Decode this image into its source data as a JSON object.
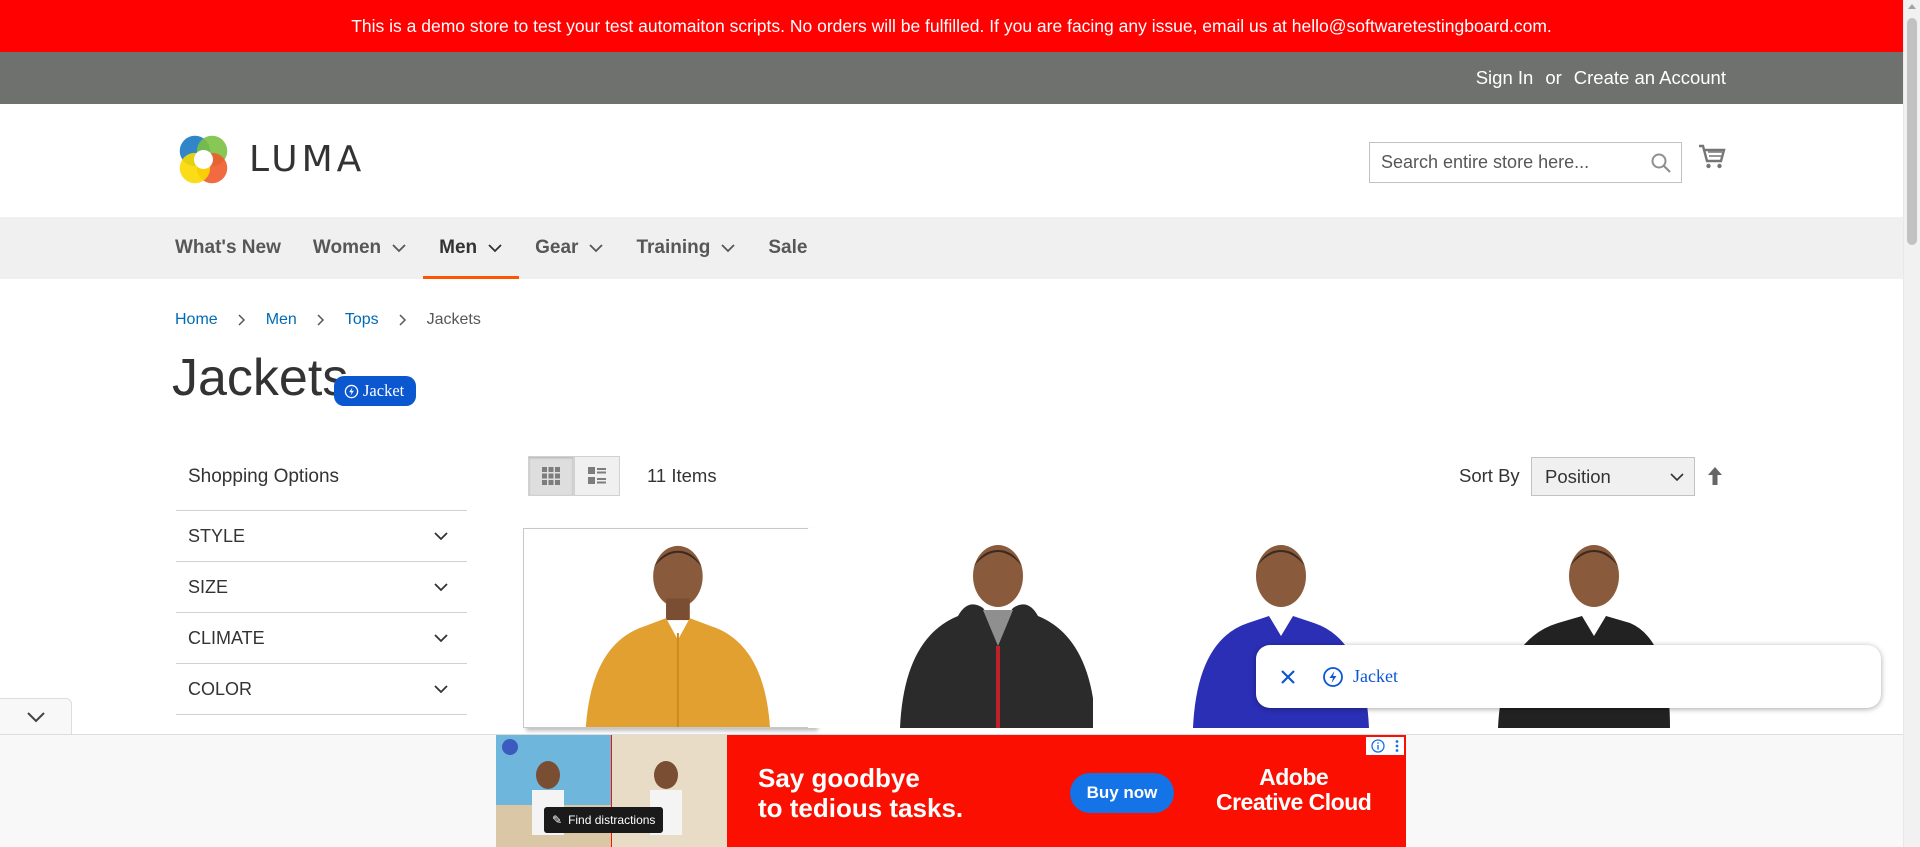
{
  "notice": {
    "text": "This is a demo store to test your test automaiton scripts. No orders will be fulfilled. If you are facing any issue, email us at hello@softwaretestingboard.com."
  },
  "header_links": {
    "sign_in": "Sign In",
    "or": "or",
    "create_account": "Create an Account"
  },
  "logo": {
    "wordmark": "LUMA"
  },
  "search": {
    "placeholder": "Search entire store here..."
  },
  "nav": {
    "items": [
      {
        "label": "What's New"
      },
      {
        "label": "Women"
      },
      {
        "label": "Men"
      },
      {
        "label": "Gear"
      },
      {
        "label": "Training"
      },
      {
        "label": "Sale"
      }
    ],
    "active": "Men"
  },
  "breadcrumbs": [
    {
      "label": "Home"
    },
    {
      "label": "Men"
    },
    {
      "label": "Tops"
    },
    {
      "label": "Jackets"
    }
  ],
  "page": {
    "title": "Jackets",
    "pill_label": "Jacket"
  },
  "sidebar": {
    "title": "Shopping Options",
    "filters": [
      "STYLE",
      "SIZE",
      "CLIMATE",
      "COLOR"
    ]
  },
  "toolbar": {
    "amount": "11 Items",
    "sort_by_label": "Sort By",
    "sort_value": "Position",
    "view_modes": [
      "grid-icon",
      "list-icon"
    ]
  },
  "popup": {
    "chip_label": "Jacket"
  },
  "ad": {
    "headline_line1": "Say goodbye",
    "headline_line2": "to tedious tasks.",
    "button": "Buy now",
    "brand_line1": "Adobe",
    "brand_line2": "Creative Cloud",
    "find_label": "Find distractions"
  },
  "colors": {
    "notice_bg": "#ff0101",
    "header_bar_bg": "#6e716e",
    "nav_bg": "#f0f0f0",
    "nav_active_underline": "#ff5501",
    "link": "#006bb4",
    "pill_bg": "#0b57d0",
    "ad_bg": "#fa0f00",
    "ad_button": "#1473e6"
  }
}
